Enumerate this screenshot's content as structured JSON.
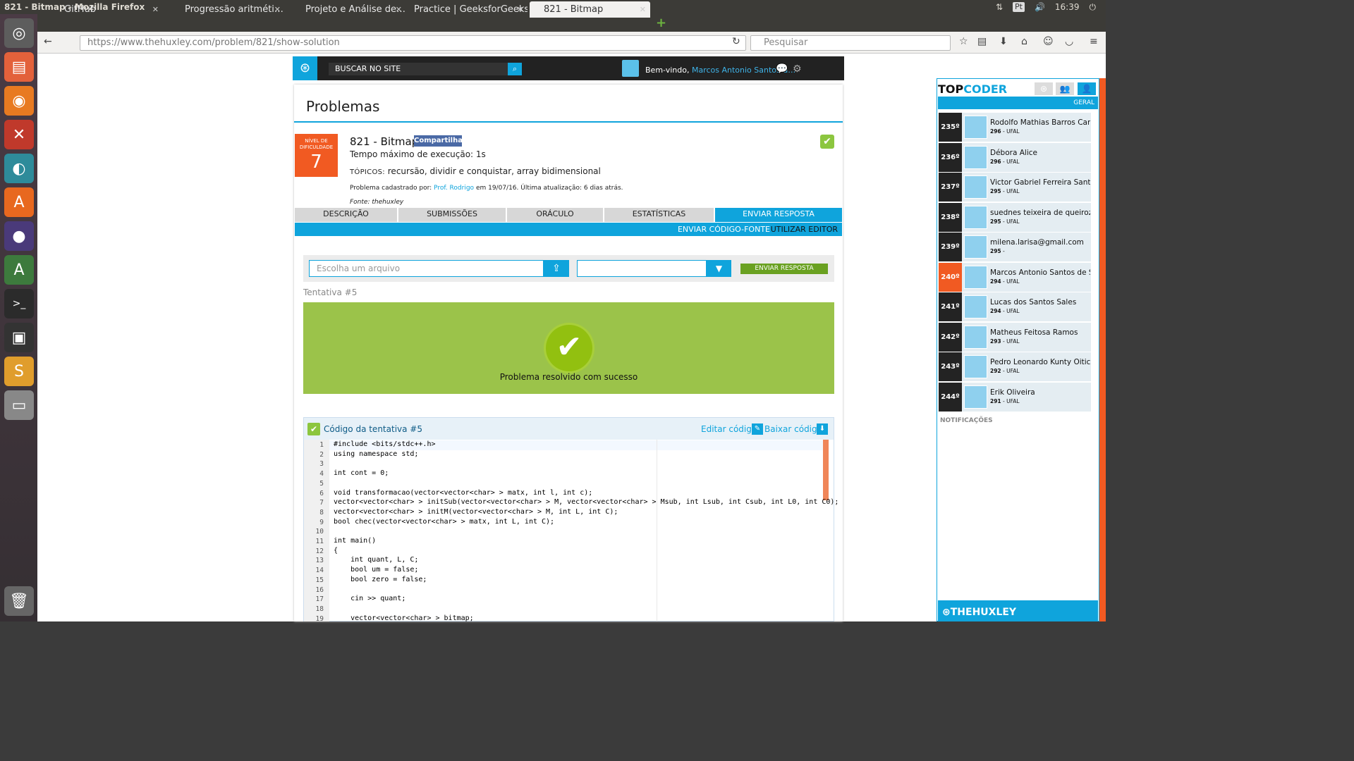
{
  "os": {
    "window_title": "821 - Bitmap - Mozilla Firefox",
    "keyboard_layout": "Pt",
    "clock": "16:39",
    "launcher_icons": [
      "ubuntu-icon",
      "files-icon",
      "firefox-icon",
      "settings-icon",
      "webcam-icon",
      "software-center-icon",
      "eclipse-icon",
      "updater-icon",
      "terminal-icon",
      "keepass-icon",
      "sublime-icon",
      "drive-icon",
      "trash-icon"
    ]
  },
  "browser": {
    "tabs": [
      {
        "label": "GitHub"
      },
      {
        "label": "Progressão aritméti…"
      },
      {
        "label": "Projeto e Análise de…"
      },
      {
        "label": "Practice | GeeksforGeeks"
      },
      {
        "label": "821 - Bitmap"
      }
    ],
    "url": "https://www.thehuxley.com/problem/821/show-solution",
    "search_placeholder": "Pesquisar"
  },
  "site": {
    "search_placeholder": "BUSCAR NO SITE",
    "welcome_prefix": "Bem-vindo,",
    "user_name": "Marcos Antonio Santos d…"
  },
  "problem": {
    "page_title": "Problemas",
    "difficulty_label": "NÍVEL DE DIFICULDADE",
    "difficulty_value": "7",
    "title": "821 - Bitmap",
    "share_label": "Compartilhar",
    "exec_time": "Tempo máximo de execução: 1s",
    "topics_label": "TÓPICOS:",
    "topics": "recursão, dividir e conquistar, array bidimensional",
    "registered_prefix": "Problema cadastrado por:",
    "registered_by": "Prof. Rodrigo",
    "registered_suffix": "em 19/07/16. Última atualização: 6 dias atrás.",
    "source": "Fonte: thehuxley",
    "tabs": [
      {
        "label": "DESCRIÇÃO"
      },
      {
        "label": "SUBMISSÕES"
      },
      {
        "label": "ORÁCULO"
      },
      {
        "label": "ESTATÍSTICAS"
      },
      {
        "label": "ENVIAR RESPOSTA"
      }
    ],
    "submit_source": "ENVIAR CÓDIGO-FONTE",
    "use_editor": "UTILIZAR EDITOR",
    "file_placeholder": "Escolha um arquivo",
    "submit_button": "ENVIAR RESPOSTA",
    "attempt": "Tentativa #5",
    "success_message": "Problema resolvido com sucesso",
    "code_title": "Código da tentativa #5",
    "edit_code": "Editar código",
    "download_code": "Baixar código"
  },
  "code": {
    "line_numbers": [
      "1",
      "2",
      "3",
      "4",
      "5",
      "6",
      "7",
      "8",
      "9",
      "10",
      "11",
      "12",
      "13",
      "14",
      "15",
      "16",
      "17",
      "18",
      "19"
    ],
    "lines": [
      "#include <bits/stdc++.h>",
      "using namespace std;",
      "",
      "int cont = 0;",
      "",
      "void transformacao(vector<vector<char> > matx, int l, int c);",
      "vector<vector<char> > initSub(vector<vector<char> > M, vector<vector<char> > Msub, int Lsub, int Csub, int L0, int C0);",
      "vector<vector<char> > initM(vector<vector<char> > M, int L, int C);",
      "bool chec(vector<vector<char> > matx, int L, int C);",
      "",
      "int main()",
      "{",
      "    int quant, L, C;",
      "    bool um = false;",
      "    bool zero = false;",
      "",
      "    cin >> quant;",
      "",
      "    vector<vector<char> > bitmap;"
    ]
  },
  "topcoder": {
    "brand_a": "TOP",
    "brand_b": "CODER",
    "filter": "GERAL",
    "ranking": [
      {
        "pos": "235º",
        "name": "Rodolfo Mathias Barros Card…",
        "score": "296",
        "inst": "- UFAL"
      },
      {
        "pos": "236º",
        "name": "Débora Alice",
        "score": "296",
        "inst": "- UFAL"
      },
      {
        "pos": "237º",
        "name": "Victor Gabriel Ferreira Santo…",
        "score": "295",
        "inst": "- UFAL"
      },
      {
        "pos": "238º",
        "name": "suednes teixeira de queiroz …",
        "score": "295",
        "inst": "- UFAL"
      },
      {
        "pos": "239º",
        "name": "milena.larisa@gmail.com",
        "score": "295",
        "inst": "-"
      },
      {
        "pos": "240º",
        "name": "Marcos Antonio Santos de S…",
        "score": "294",
        "inst": "- UFAL"
      },
      {
        "pos": "241º",
        "name": "Lucas dos Santos Sales",
        "score": "294",
        "inst": "- UFAL"
      },
      {
        "pos": "242º",
        "name": "Matheus Feitosa Ramos",
        "score": "293",
        "inst": "- UFAL"
      },
      {
        "pos": "243º",
        "name": "Pedro Leonardo Kunty Oitici…",
        "score": "292",
        "inst": "- UFAL"
      },
      {
        "pos": "244º",
        "name": "Erik Oliveira",
        "score": "291",
        "inst": "- UFAL"
      }
    ],
    "notifications": "NOTIFICAÇÕES",
    "footer": "THEHUXLEY"
  },
  "colors": {
    "accent": "#0fa4dc",
    "highlight": "#f15a22",
    "success": "#9bc34a"
  }
}
